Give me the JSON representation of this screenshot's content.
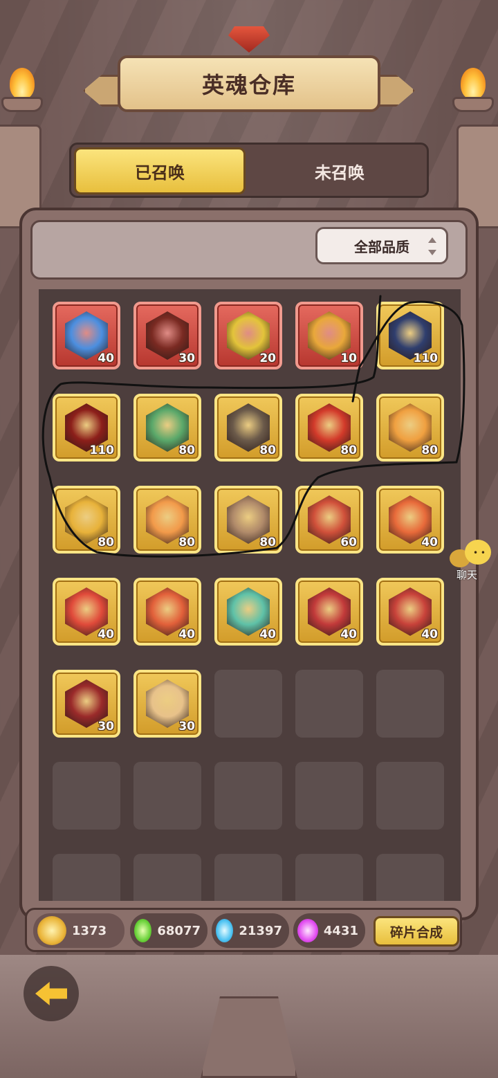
{
  "header": {
    "title": "英魂仓库"
  },
  "tabs": [
    {
      "label": "已召唤",
      "active": true
    },
    {
      "label": "未召唤",
      "active": false
    }
  ],
  "filter": {
    "quality_label": "全部品质",
    "icon": "sort-arrows-icon"
  },
  "cards": [
    {
      "frame": "red",
      "count": "40",
      "color": "#4c8fe0"
    },
    {
      "frame": "red",
      "count": "30",
      "color": "#7a2a22"
    },
    {
      "frame": "red",
      "count": "20",
      "color": "#e3c43a"
    },
    {
      "frame": "red",
      "count": "10",
      "color": "#e9a83a"
    },
    {
      "frame": "gold",
      "count": "110",
      "color": "#2f3e6e"
    },
    {
      "frame": "gold",
      "count": "110",
      "color": "#8c1f1a"
    },
    {
      "frame": "gold",
      "count": "80",
      "color": "#5aa86a"
    },
    {
      "frame": "gold",
      "count": "80",
      "color": "#6b5a4a"
    },
    {
      "frame": "gold",
      "count": "80",
      "color": "#d23a2a"
    },
    {
      "frame": "gold",
      "count": "80",
      "color": "#f0a040"
    },
    {
      "frame": "gold",
      "count": "80",
      "color": "#e8b23a"
    },
    {
      "frame": "gold",
      "count": "80",
      "color": "#f29a4a"
    },
    {
      "frame": "gold",
      "count": "80",
      "color": "#b08a6a"
    },
    {
      "frame": "gold",
      "count": "60",
      "color": "#d0503a"
    },
    {
      "frame": "gold",
      "count": "40",
      "color": "#e86a3a"
    },
    {
      "frame": "gold",
      "count": "40",
      "color": "#e04a3a"
    },
    {
      "frame": "gold",
      "count": "40",
      "color": "#e2603a"
    },
    {
      "frame": "gold",
      "count": "40",
      "color": "#5fc2a8"
    },
    {
      "frame": "gold",
      "count": "40",
      "color": "#c23a3a"
    },
    {
      "frame": "gold",
      "count": "40",
      "color": "#c8423a"
    },
    {
      "frame": "gold",
      "count": "30",
      "color": "#9a2a2a"
    },
    {
      "frame": "gold",
      "count": "30",
      "color": "#e8c28a"
    },
    {
      "frame": "empty"
    },
    {
      "frame": "empty"
    },
    {
      "frame": "empty"
    },
    {
      "frame": "empty"
    },
    {
      "frame": "empty"
    },
    {
      "frame": "empty"
    },
    {
      "frame": "empty"
    },
    {
      "frame": "empty"
    },
    {
      "frame": "empty"
    },
    {
      "frame": "empty"
    },
    {
      "frame": "empty"
    },
    {
      "frame": "empty"
    },
    {
      "frame": "empty"
    }
  ],
  "chat": {
    "label": "聊天",
    "icon": "chat-bubble-icon"
  },
  "currencies": [
    {
      "value": "1373",
      "icon": "gold-soul-icon",
      "color": "#eab53a"
    },
    {
      "value": "68077",
      "icon": "green-soul-icon",
      "color": "#6ad23a"
    },
    {
      "value": "21397",
      "icon": "blue-soul-icon",
      "color": "#4ec3f2"
    },
    {
      "value": "4431",
      "icon": "purple-soul-icon",
      "color": "#e24ef0"
    }
  ],
  "actions": {
    "synthesize_label": "碎片合成"
  },
  "nav": {
    "back_icon": "back-arrow-icon"
  }
}
